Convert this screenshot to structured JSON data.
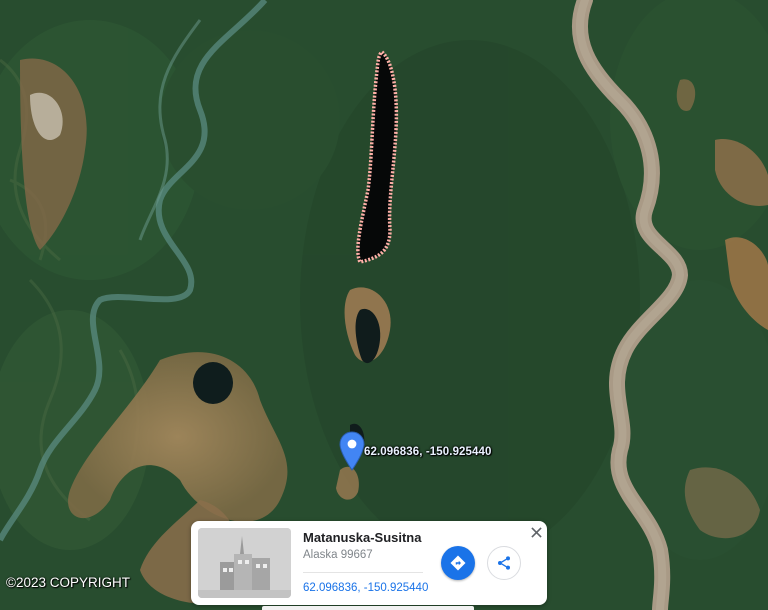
{
  "map": {
    "type": "satellite",
    "region_feature": "lake-outline",
    "outline_color": "#ffb0a8"
  },
  "marker": {
    "coords_label": "62.096836, -150.925440",
    "icon": "map-pin-icon",
    "color": "#4285f4"
  },
  "copyright": "©2023 COPYRIGHT",
  "info_card": {
    "title": "Matanuska-Susitna",
    "subtitle": "Alaska 99667",
    "coordinates": "62.096836, -150.925440",
    "directions_icon": "directions-icon",
    "share_icon": "share-icon",
    "close_icon": "close-icon",
    "thumbnail_icon": "building-thumbnail",
    "accent_color": "#1a73e8"
  }
}
